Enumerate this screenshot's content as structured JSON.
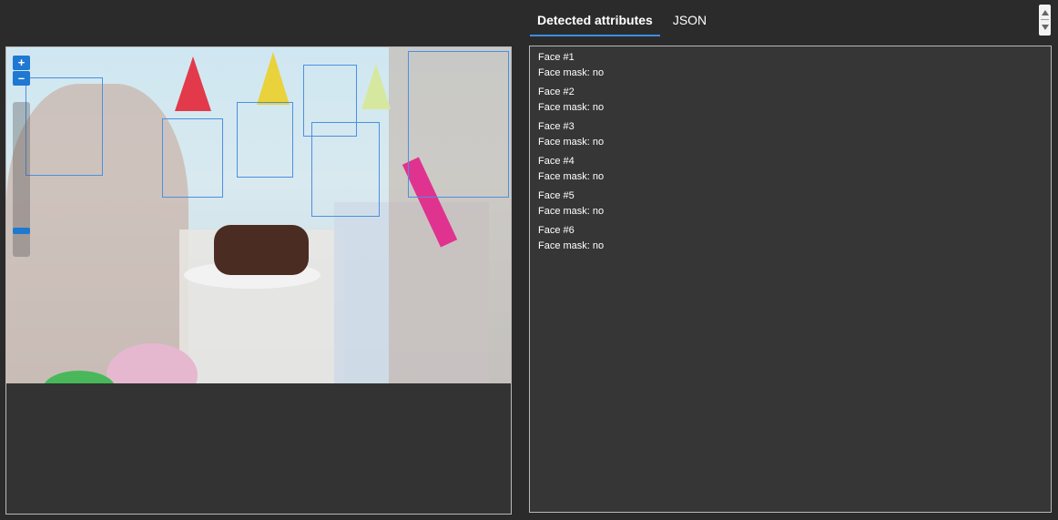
{
  "tabs": {
    "detected_attributes": "Detected attributes",
    "json": "JSON"
  },
  "zoom": {
    "zoom_in_label": "+",
    "zoom_out_label": "–"
  },
  "faces": [
    {
      "title": "Face #1",
      "attribute": "Face mask: no"
    },
    {
      "title": "Face #2",
      "attribute": "Face mask: no"
    },
    {
      "title": "Face #3",
      "attribute": "Face mask: no"
    },
    {
      "title": "Face #4",
      "attribute": "Face mask: no"
    },
    {
      "title": "Face #5",
      "attribute": "Face mask: no"
    },
    {
      "title": "Face #6",
      "attribute": "Face mask: no"
    }
  ],
  "colors": {
    "accent": "#3b8fe0",
    "box": "#4a90e2",
    "panel": "#363636",
    "background": "#2b2b2b"
  }
}
